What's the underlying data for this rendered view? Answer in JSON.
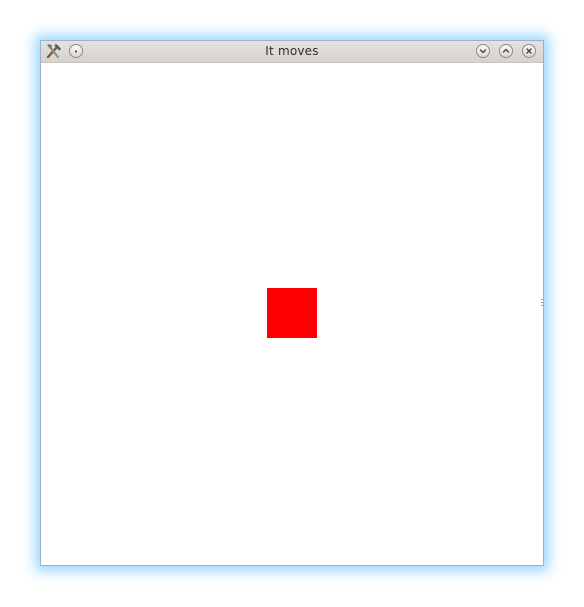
{
  "window": {
    "title": "It moves"
  },
  "titlebar": {
    "app_icon": "tools-icon",
    "menu_icon": "window-menu-icon",
    "minimize_icon": "chevron-down-icon",
    "maximize_icon": "chevron-up-icon",
    "close_icon": "close-icon"
  },
  "canvas": {
    "shape": "square",
    "shape_color": "#ff0000",
    "background_color": "#ffffff"
  }
}
